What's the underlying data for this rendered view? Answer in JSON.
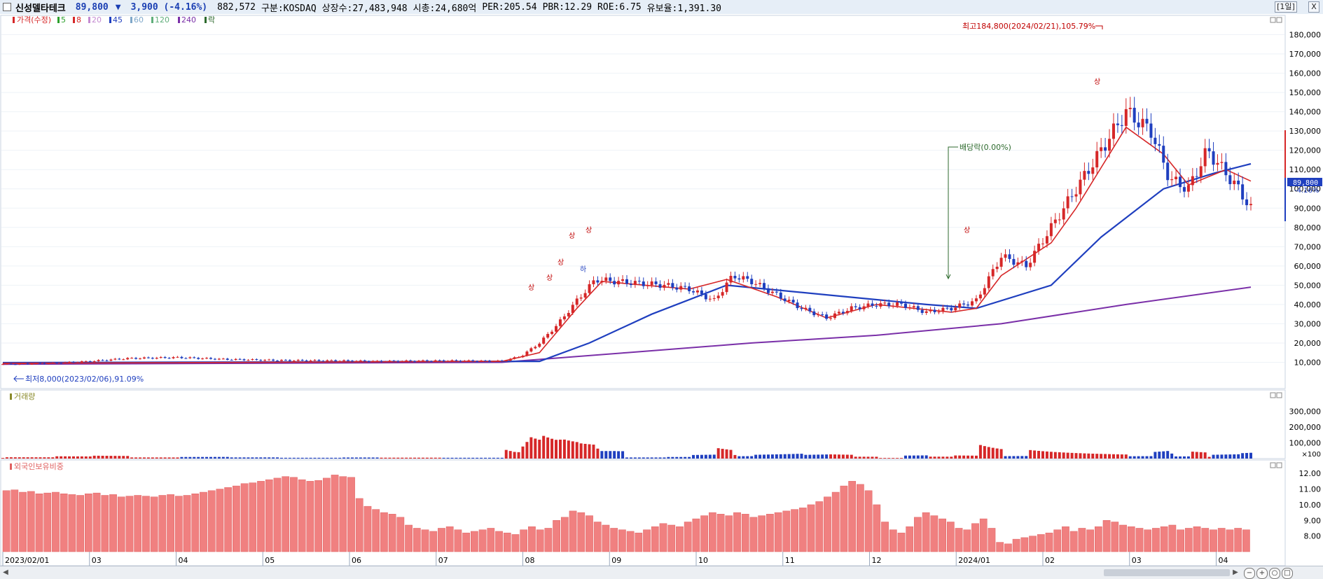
{
  "header": {
    "stock_name": "신성델타테크",
    "price": "89,800",
    "change_arrow": "▼",
    "change": "3,900 (-4.16%)",
    "volume": "882,572",
    "market": "구분:KOSDAQ",
    "shares": "상장수:27,483,948",
    "market_cap": "시총:24,680억",
    "per": "PER:205.54",
    "pbr": "PBR:12.29",
    "roe": "ROE:6.75",
    "float": "유보율:1,391.30",
    "period_button": "[1일]",
    "close_button": "X"
  },
  "legend": {
    "price_label": "가격(수정)",
    "ma_items": [
      {
        "label": "5",
        "color": "#2ca02c"
      },
      {
        "label": "8",
        "color": "#d62728"
      },
      {
        "label": "20",
        "color": "#c48ad1"
      },
      {
        "label": "45",
        "color": "#1f3fbf"
      },
      {
        "label": "60",
        "color": "#7fa7c9"
      },
      {
        "label": "120",
        "color": "#5fae7a"
      },
      {
        "label": "240",
        "color": "#7a2fa8"
      }
    ],
    "ex_label": "락",
    "volume_label": "거래량",
    "foreign_label": "외국인보유비중"
  },
  "annotations": {
    "high": "최고184,800(2024/02/21),105.79%",
    "low": "최저8,000(2023/02/06),91.09%",
    "dividend": "배당락(0.00%)",
    "up_marker": "상",
    "down_marker": "하",
    "current_price": "89,800",
    "current_change": "-4.16%"
  },
  "chart_data": {
    "type": "candlestick",
    "x_ticks": [
      "2023/02/01",
      "03",
      "04",
      "05",
      "06",
      "07",
      "08",
      "09",
      "10",
      "11",
      "12",
      "2024/01",
      "02",
      "03",
      "04"
    ],
    "price_panel": {
      "y_ticks": [
        "10,000",
        "20,000",
        "30,000",
        "40,000",
        "50,000",
        "60,000",
        "70,000",
        "80,000",
        "90,000",
        "100,000",
        "110,000",
        "120,000",
        "130,000",
        "140,000",
        "150,000",
        "160,000",
        "170,000",
        "180,000"
      ],
      "ylim": [
        0,
        190000
      ],
      "close_series": [
        {
          "t": 0,
          "v": 9000
        },
        {
          "t": 0.04,
          "v": 9500
        },
        {
          "t": 0.07,
          "v": 10500
        },
        {
          "t": 0.1,
          "v": 12000
        },
        {
          "t": 0.14,
          "v": 12500
        },
        {
          "t": 0.18,
          "v": 11500
        },
        {
          "t": 0.22,
          "v": 11000
        },
        {
          "t": 0.27,
          "v": 10800
        },
        {
          "t": 0.3,
          "v": 10500
        },
        {
          "t": 0.35,
          "v": 10800
        },
        {
          "t": 0.4,
          "v": 10600
        },
        {
          "t": 0.405,
          "v": 11500
        },
        {
          "t": 0.415,
          "v": 13000
        },
        {
          "t": 0.43,
          "v": 20000
        },
        {
          "t": 0.445,
          "v": 30000
        },
        {
          "t": 0.46,
          "v": 42000
        },
        {
          "t": 0.475,
          "v": 53000
        },
        {
          "t": 0.49,
          "v": 52000
        },
        {
          "t": 0.51,
          "v": 51000
        },
        {
          "t": 0.53,
          "v": 50000
        },
        {
          "t": 0.55,
          "v": 48000
        },
        {
          "t": 0.57,
          "v": 42000
        },
        {
          "t": 0.585,
          "v": 55000
        },
        {
          "t": 0.6,
          "v": 52000
        },
        {
          "t": 0.62,
          "v": 45000
        },
        {
          "t": 0.64,
          "v": 38000
        },
        {
          "t": 0.66,
          "v": 33000
        },
        {
          "t": 0.68,
          "v": 38000
        },
        {
          "t": 0.7,
          "v": 40000
        },
        {
          "t": 0.72,
          "v": 40000
        },
        {
          "t": 0.74,
          "v": 36000
        },
        {
          "t": 0.76,
          "v": 38000
        },
        {
          "t": 0.78,
          "v": 42000
        },
        {
          "t": 0.8,
          "v": 65000
        },
        {
          "t": 0.82,
          "v": 60000
        },
        {
          "t": 0.84,
          "v": 80000
        },
        {
          "t": 0.86,
          "v": 100000
        },
        {
          "t": 0.88,
          "v": 120000
        },
        {
          "t": 0.9,
          "v": 140000
        },
        {
          "t": 0.92,
          "v": 130000
        },
        {
          "t": 0.935,
          "v": 105000
        },
        {
          "t": 0.95,
          "v": 100000
        },
        {
          "t": 0.965,
          "v": 120000
        },
        {
          "t": 0.98,
          "v": 108000
        },
        {
          "t": 0.99,
          "v": 100000
        },
        {
          "t": 1.0,
          "v": 89800
        }
      ],
      "ma_8_series": [
        {
          "t": 0,
          "v": 9500
        },
        {
          "t": 0.4,
          "v": 10500
        },
        {
          "t": 0.43,
          "v": 15000
        },
        {
          "t": 0.46,
          "v": 38000
        },
        {
          "t": 0.48,
          "v": 52000
        },
        {
          "t": 0.55,
          "v": 48000
        },
        {
          "t": 0.58,
          "v": 53000
        },
        {
          "t": 0.62,
          "v": 44000
        },
        {
          "t": 0.66,
          "v": 33000
        },
        {
          "t": 0.7,
          "v": 40000
        },
        {
          "t": 0.76,
          "v": 36000
        },
        {
          "t": 0.78,
          "v": 38000
        },
        {
          "t": 0.8,
          "v": 55000
        },
        {
          "t": 0.84,
          "v": 72000
        },
        {
          "t": 0.86,
          "v": 90000
        },
        {
          "t": 0.9,
          "v": 132000
        },
        {
          "t": 0.93,
          "v": 118000
        },
        {
          "t": 0.95,
          "v": 102000
        },
        {
          "t": 0.98,
          "v": 110000
        },
        {
          "t": 1.0,
          "v": 104000
        }
      ],
      "ma_45_series": [
        {
          "t": 0,
          "v": 9800
        },
        {
          "t": 0.43,
          "v": 10500
        },
        {
          "t": 0.47,
          "v": 20000
        },
        {
          "t": 0.52,
          "v": 35000
        },
        {
          "t": 0.58,
          "v": 50000
        },
        {
          "t": 0.66,
          "v": 45000
        },
        {
          "t": 0.74,
          "v": 40000
        },
        {
          "t": 0.78,
          "v": 38000
        },
        {
          "t": 0.84,
          "v": 50000
        },
        {
          "t": 0.88,
          "v": 75000
        },
        {
          "t": 0.93,
          "v": 100000
        },
        {
          "t": 0.97,
          "v": 108000
        },
        {
          "t": 1.0,
          "v": 113000
        }
      ],
      "ma_240_series": [
        {
          "t": 0,
          "v": 9000
        },
        {
          "t": 0.4,
          "v": 10000
        },
        {
          "t": 0.5,
          "v": 15000
        },
        {
          "t": 0.6,
          "v": 20000
        },
        {
          "t": 0.7,
          "v": 24000
        },
        {
          "t": 0.8,
          "v": 30000
        },
        {
          "t": 0.9,
          "v": 40000
        },
        {
          "t": 1.0,
          "v": 49000
        }
      ]
    },
    "volume_panel": {
      "y_ticks": [
        "300,000",
        "200,000",
        "100,000"
      ],
      "unit_label": "×100",
      "ylim": [
        0,
        400000
      ]
    },
    "foreign_panel": {
      "y_ticks": [
        "12.00",
        "11.00",
        "10.00",
        "9.00",
        "8.00"
      ],
      "ylim": [
        7.0,
        12.5
      ],
      "values": [
        10.9,
        10.95,
        10.8,
        10.85,
        10.7,
        10.75,
        10.8,
        10.7,
        10.65,
        10.6,
        10.7,
        10.75,
        10.6,
        10.65,
        10.5,
        10.55,
        10.6,
        10.55,
        10.5,
        10.6,
        10.65,
        10.55,
        10.6,
        10.7,
        10.8,
        10.9,
        11.0,
        11.1,
        11.2,
        11.35,
        11.4,
        11.5,
        11.6,
        11.7,
        11.8,
        11.75,
        11.6,
        11.5,
        11.55,
        11.7,
        11.9,
        11.8,
        11.75,
        10.4,
        9.9,
        9.7,
        9.5,
        9.4,
        9.2,
        8.7,
        8.5,
        8.4,
        8.3,
        8.5,
        8.6,
        8.4,
        8.2,
        8.3,
        8.4,
        8.5,
        8.3,
        8.2,
        8.1,
        8.4,
        8.6,
        8.4,
        8.5,
        9.0,
        9.2,
        9.6,
        9.5,
        9.3,
        8.9,
        8.7,
        8.5,
        8.4,
        8.3,
        8.2,
        8.4,
        8.6,
        8.8,
        8.7,
        8.6,
        8.9,
        9.1,
        9.3,
        9.5,
        9.4,
        9.3,
        9.5,
        9.4,
        9.2,
        9.3,
        9.4,
        9.5,
        9.6,
        9.7,
        9.8,
        10.0,
        10.2,
        10.5,
        10.8,
        11.2,
        11.5,
        11.3,
        10.9,
        10.0,
        8.9,
        8.4,
        8.2,
        8.6,
        9.2,
        9.5,
        9.3,
        9.1,
        8.9,
        8.5,
        8.4,
        8.8,
        9.1,
        8.5,
        7.6,
        7.5,
        7.8,
        7.9,
        8.0,
        8.1,
        8.2,
        8.4,
        8.6,
        8.3,
        8.5,
        8.4,
        8.6,
        9.0,
        8.9,
        8.7,
        8.6,
        8.5,
        8.4,
        8.5,
        8.6,
        8.7,
        8.4,
        8.5,
        8.6,
        8.5,
        8.4,
        8.5,
        8.4,
        8.5,
        8.4
      ]
    }
  }
}
